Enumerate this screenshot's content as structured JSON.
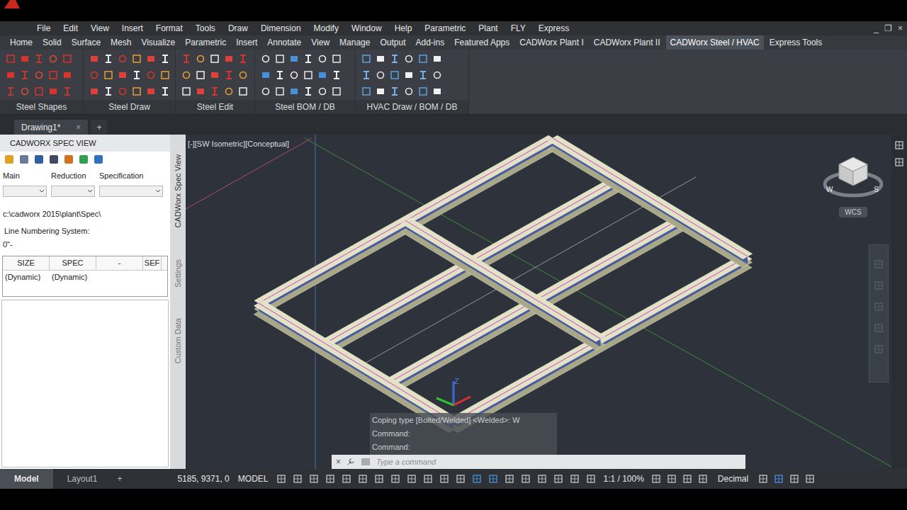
{
  "window": {
    "controls": [
      "_",
      "❐",
      "×"
    ]
  },
  "menu_bar": {
    "items": [
      "File",
      "Edit",
      "View",
      "Insert",
      "Format",
      "Tools",
      "Draw",
      "Dimension",
      "Modify",
      "Window",
      "Help",
      "Parametric",
      "Plant",
      "FLY",
      "Express"
    ]
  },
  "ribbon_tabs": [
    {
      "label": "Home",
      "selected": false
    },
    {
      "label": "Solid",
      "selected": false
    },
    {
      "label": "Surface",
      "selected": false
    },
    {
      "label": "Mesh",
      "selected": false
    },
    {
      "label": "Visualize",
      "selected": false
    },
    {
      "label": "Parametric",
      "selected": false
    },
    {
      "label": "Insert",
      "selected": false
    },
    {
      "label": "Annotate",
      "selected": false
    },
    {
      "label": "View",
      "selected": false
    },
    {
      "label": "Manage",
      "selected": false
    },
    {
      "label": "Output",
      "selected": false
    },
    {
      "label": "Add-ins",
      "selected": false
    },
    {
      "label": "Featured Apps",
      "selected": false
    },
    {
      "label": "CADWorx Plant I",
      "selected": false
    },
    {
      "label": "CADWorx Plant II",
      "selected": false
    },
    {
      "label": "CADWorx Steel / HVAC",
      "selected": true
    },
    {
      "label": "Express Tools",
      "selected": false
    }
  ],
  "ribbon_panels": [
    {
      "label": "Steel Shapes"
    },
    {
      "label": "Steel Draw"
    },
    {
      "label": "Steel Edit"
    },
    {
      "label": "Steel BOM / DB"
    },
    {
      "label": "HVAC Draw / BOM / DB"
    }
  ],
  "file_tabs": [
    {
      "label": "Drawing1*",
      "selected": true,
      "close": "×"
    }
  ],
  "new_tab": "+",
  "palette": {
    "title": "CADWORX SPEC VIEW",
    "fields": [
      {
        "label": "Main",
        "value": ""
      },
      {
        "label": "Reduction",
        "value": ""
      },
      {
        "label": "Specification",
        "value": ""
      }
    ],
    "path": "c:\\cadworx 2015\\plant\\Spec\\",
    "line_numbering_label": "Line Numbering System:",
    "line_numbering_value": "0\"-",
    "table": {
      "columns": [
        "SIZE",
        "SPEC",
        "-",
        "SEF"
      ],
      "rows": [
        [
          "(Dynamic)",
          "(Dynamic)",
          "",
          ""
        ]
      ]
    },
    "side_tabs": [
      {
        "label": "CADWorx Spec View",
        "selected": true
      },
      {
        "label": "Settings",
        "selected": false
      },
      {
        "label": "Custom Data",
        "selected": false
      }
    ]
  },
  "viewport": {
    "label": "[-][SW Isometric][Conceptual]",
    "ucs_axis": "Z",
    "compass": [
      "W",
      "S"
    ],
    "wcs": "WCS"
  },
  "command_line": {
    "history": [
      "Coping type [Bolted/Welded] <Welded>: W",
      "Command:",
      "Command:"
    ],
    "placeholder": "Type a command",
    "close": "×"
  },
  "status_bar": {
    "layouts": [
      {
        "label": "Model",
        "selected": true
      },
      {
        "label": "Layout1",
        "selected": false
      }
    ],
    "add": "+",
    "coordinates": "5185, 9371, 0",
    "space": "MODEL",
    "scale": "1:1 / 100%",
    "units": "Decimal"
  }
}
